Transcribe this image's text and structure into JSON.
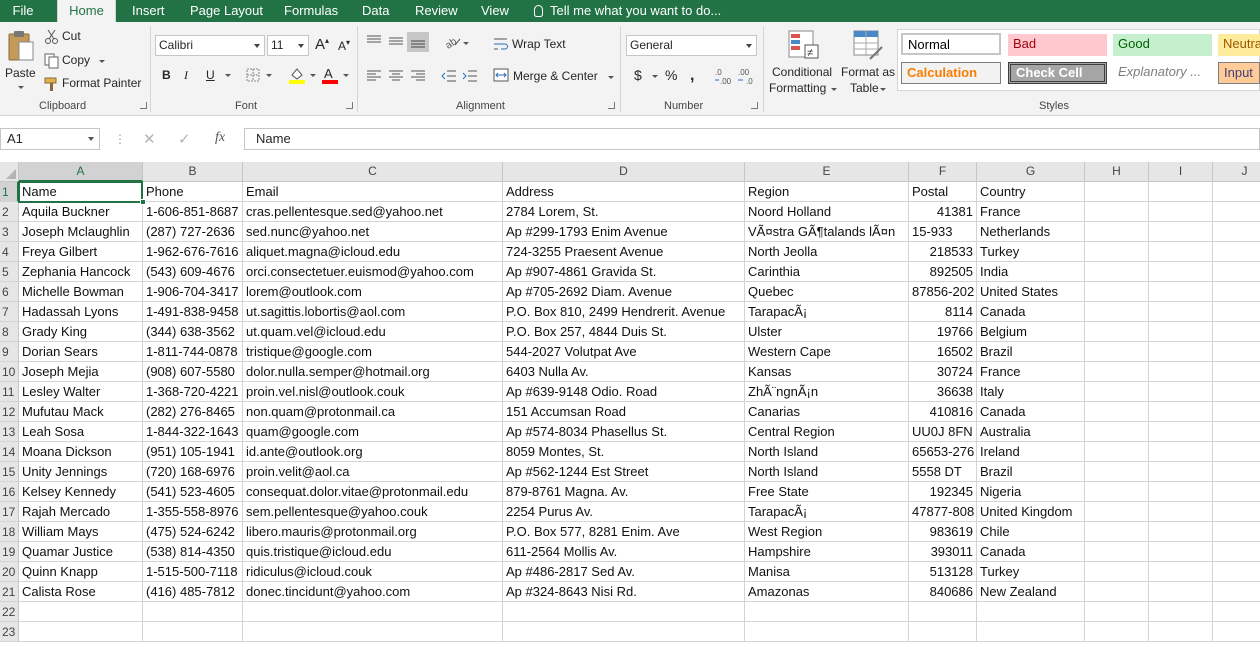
{
  "menu": {
    "tabs": [
      "File",
      "Home",
      "Insert",
      "Page Layout",
      "Formulas",
      "Data",
      "Review",
      "View"
    ],
    "active": "Home",
    "tell_me": "Tell me what you want to do..."
  },
  "ribbon": {
    "clipboard": {
      "paste": "Paste",
      "cut": "Cut",
      "copy": "Copy",
      "format_painter": "Format Painter",
      "label": "Clipboard"
    },
    "font": {
      "name": "Calibri",
      "size": "11",
      "label": "Font"
    },
    "alignment": {
      "wrap_text": "Wrap Text",
      "merge_center": "Merge & Center",
      "label": "Alignment"
    },
    "number": {
      "format": "General",
      "label": "Number"
    },
    "styles": {
      "conditional_formatting": "Conditional Formatting",
      "format_as_table": "Format as Table",
      "cells": [
        "Normal",
        "Bad",
        "Good",
        "Neutral",
        "Calculation",
        "Check Cell",
        "Explanatory ...",
        "Input"
      ],
      "label": "Styles"
    }
  },
  "formula_bar": {
    "name_box": "A1",
    "formula": "Name"
  },
  "columns": [
    "A",
    "B",
    "C",
    "D",
    "E",
    "F",
    "G",
    "H",
    "I",
    "J"
  ],
  "row_numbers": [
    "1",
    "2",
    "3",
    "4",
    "5",
    "6",
    "7",
    "8",
    "9",
    "10",
    "11",
    "12",
    "13",
    "14",
    "15",
    "16",
    "17",
    "18",
    "19",
    "20",
    "21",
    "22",
    "23"
  ],
  "sheet": {
    "rows": [
      [
        "Name",
        "Phone",
        "Email",
        "Address",
        "Region",
        "Postal",
        "Country"
      ],
      [
        "Aquila Buckner",
        "1-606-851-8687",
        "cras.pellentesque.sed@yahoo.net",
        "2784 Lorem, St.",
        "Noord Holland",
        "41381",
        "France"
      ],
      [
        "Joseph Mclaughlin",
        "(287) 727-2636",
        "sed.nunc@yahoo.net",
        "Ap #299-1793 Enim Avenue",
        "VÃ¤stra GÃ¶talands lÃ¤n",
        "15-933",
        "Netherlands"
      ],
      [
        "Freya Gilbert",
        "1-962-676-7616",
        "aliquet.magna@icloud.edu",
        "724-3255 Praesent Avenue",
        "North Jeolla",
        "218533",
        "Turkey"
      ],
      [
        "Zephania Hancock",
        "(543) 609-4676",
        "orci.consectetuer.euismod@yahoo.com",
        "Ap #907-4861 Gravida St.",
        "Carinthia",
        "892505",
        "India"
      ],
      [
        "Michelle Bowman",
        "1-906-704-3417",
        "lorem@outlook.com",
        "Ap #705-2692 Diam. Avenue",
        "Quebec",
        "87856-202",
        "United States"
      ],
      [
        "Hadassah Lyons",
        "1-491-838-9458",
        "ut.sagittis.lobortis@aol.com",
        "P.O. Box 810, 2499 Hendrerit. Avenue",
        "TarapacÃ¡",
        "8114",
        "Canada"
      ],
      [
        "Grady King",
        "(344) 638-3562",
        "ut.quam.vel@icloud.edu",
        "P.O. Box 257, 4844 Duis St.",
        "Ulster",
        "19766",
        "Belgium"
      ],
      [
        "Dorian Sears",
        "1-811-744-0878",
        "tristique@google.com",
        "544-2027 Volutpat Ave",
        "Western Cape",
        "16502",
        "Brazil"
      ],
      [
        "Joseph Mejia",
        "(908) 607-5580",
        "dolor.nulla.semper@hotmail.org",
        "6403 Nulla Av.",
        "Kansas",
        "30724",
        "France"
      ],
      [
        "Lesley Walter",
        "1-368-720-4221",
        "proin.vel.nisl@outlook.couk",
        "Ap #639-9148 Odio. Road",
        "ZhÃ¨ngnÃ¡n",
        "36638",
        "Italy"
      ],
      [
        "Mufutau Mack",
        "(282) 276-8465",
        "non.quam@protonmail.ca",
        "151 Accumsan Road",
        "Canarias",
        "410816",
        "Canada"
      ],
      [
        "Leah Sosa",
        "1-844-322-1643",
        "quam@google.com",
        "Ap #574-8034 Phasellus St.",
        "Central Region",
        "UU0J 8FN",
        "Australia"
      ],
      [
        "Moana Dickson",
        "(951) 105-1941",
        "id.ante@outlook.org",
        "8059 Montes, St.",
        "North Island",
        "65653-276",
        "Ireland"
      ],
      [
        "Unity Jennings",
        "(720) 168-6976",
        "proin.velit@aol.ca",
        "Ap #562-1244 Est Street",
        "North Island",
        "5558 DT",
        "Brazil"
      ],
      [
        "Kelsey Kennedy",
        "(541) 523-4605",
        "consequat.dolor.vitae@protonmail.edu",
        "879-8761 Magna. Av.",
        "Free State",
        "192345",
        "Nigeria"
      ],
      [
        "Rajah Mercado",
        "1-355-558-8976",
        "sem.pellentesque@yahoo.couk",
        "2254 Purus Av.",
        "TarapacÃ¡",
        "47877-808",
        "United Kingdom"
      ],
      [
        "William Mays",
        "(475) 524-6242",
        "libero.mauris@protonmail.org",
        "P.O. Box 577, 8281 Enim. Ave",
        "West Region",
        "983619",
        "Chile"
      ],
      [
        "Quamar Justice",
        "(538) 814-4350",
        "quis.tristique@icloud.edu",
        "611-2564 Mollis Av.",
        "Hampshire",
        "393011",
        "Canada"
      ],
      [
        "Quinn Knapp",
        "1-515-500-7118",
        "ridiculus@icloud.couk",
        "Ap #486-2817 Sed Av.",
        "Manisa",
        "513128",
        "Turkey"
      ],
      [
        "Calista Rose",
        "(416) 485-7812",
        "donec.tincidunt@yahoo.com",
        "Ap #324-8643 Nisi Rd.",
        "Amazonas",
        "840686",
        "New Zealand"
      ]
    ]
  },
  "colors": {
    "accent": "#217346",
    "bad_bg": "#ffc7ce",
    "bad_fg": "#9c0006",
    "good_bg": "#c6efce",
    "good_fg": "#006100",
    "neutral_bg": "#ffeb9c",
    "neutral_fg": "#9c5700",
    "calc_fg": "#fa7d00",
    "check_bg": "#a5a5a5",
    "input_bg": "#ffcc99"
  }
}
